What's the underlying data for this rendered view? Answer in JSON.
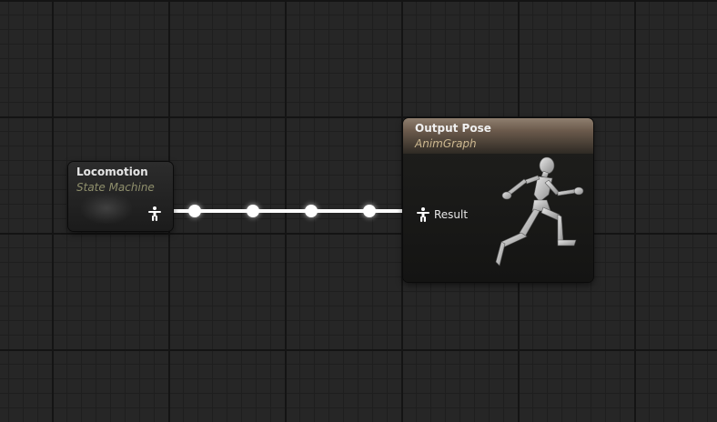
{
  "nodes": {
    "locomotion": {
      "title": "Locomotion",
      "subtitle": "State Machine"
    },
    "output_pose": {
      "title": "Output Pose",
      "subtitle": "AnimGraph",
      "input_pin_label": "Result"
    }
  },
  "icons": {
    "pose_pin": "pose-pin-icon",
    "preview": "running-mannequin-icon"
  },
  "colors": {
    "graph_background": "#262626",
    "output_header": "#7d6c5d",
    "wire": "#ffffff",
    "subtitle_state_machine": "#8f8f6c",
    "subtitle_animgraph": "#cdb890"
  }
}
